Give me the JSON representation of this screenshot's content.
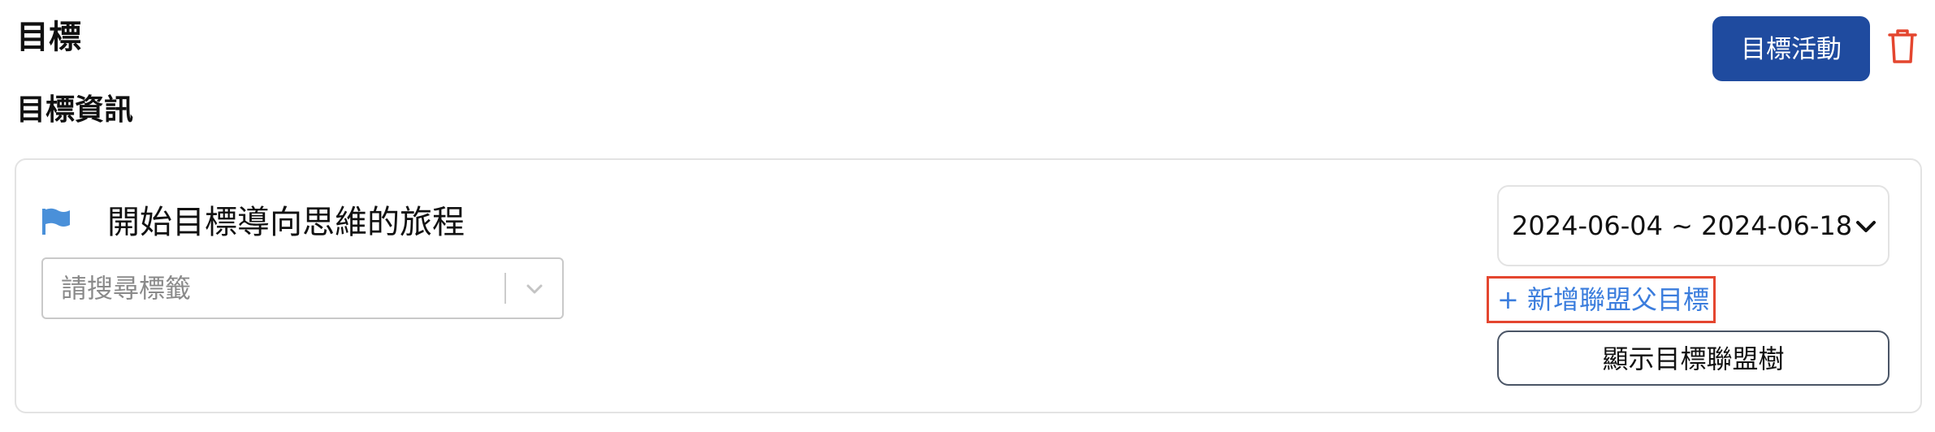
{
  "header": {
    "title": "目標",
    "activity_button_label": "目標活動",
    "delete_icon": "trash-icon",
    "accent_color": "#1f4b9f",
    "delete_color": "#e4462f"
  },
  "section": {
    "title": "目標資訊"
  },
  "goal": {
    "flag_icon": "flag-icon",
    "flag_color": "#4a90d9",
    "title": "開始目標導向思維的旅程",
    "tag_search": {
      "placeholder": "請搜尋標籤",
      "dropdown_icon": "chevron-down-icon"
    },
    "date_range": {
      "label": "2024-06-04 ~ 2024-06-18",
      "dropdown_icon": "chevron-down-icon"
    },
    "add_parent_link": "+ 新增聯盟父目標",
    "link_color": "#3b7ddd",
    "show_tree_button": "顯示目標聯盟樹"
  }
}
